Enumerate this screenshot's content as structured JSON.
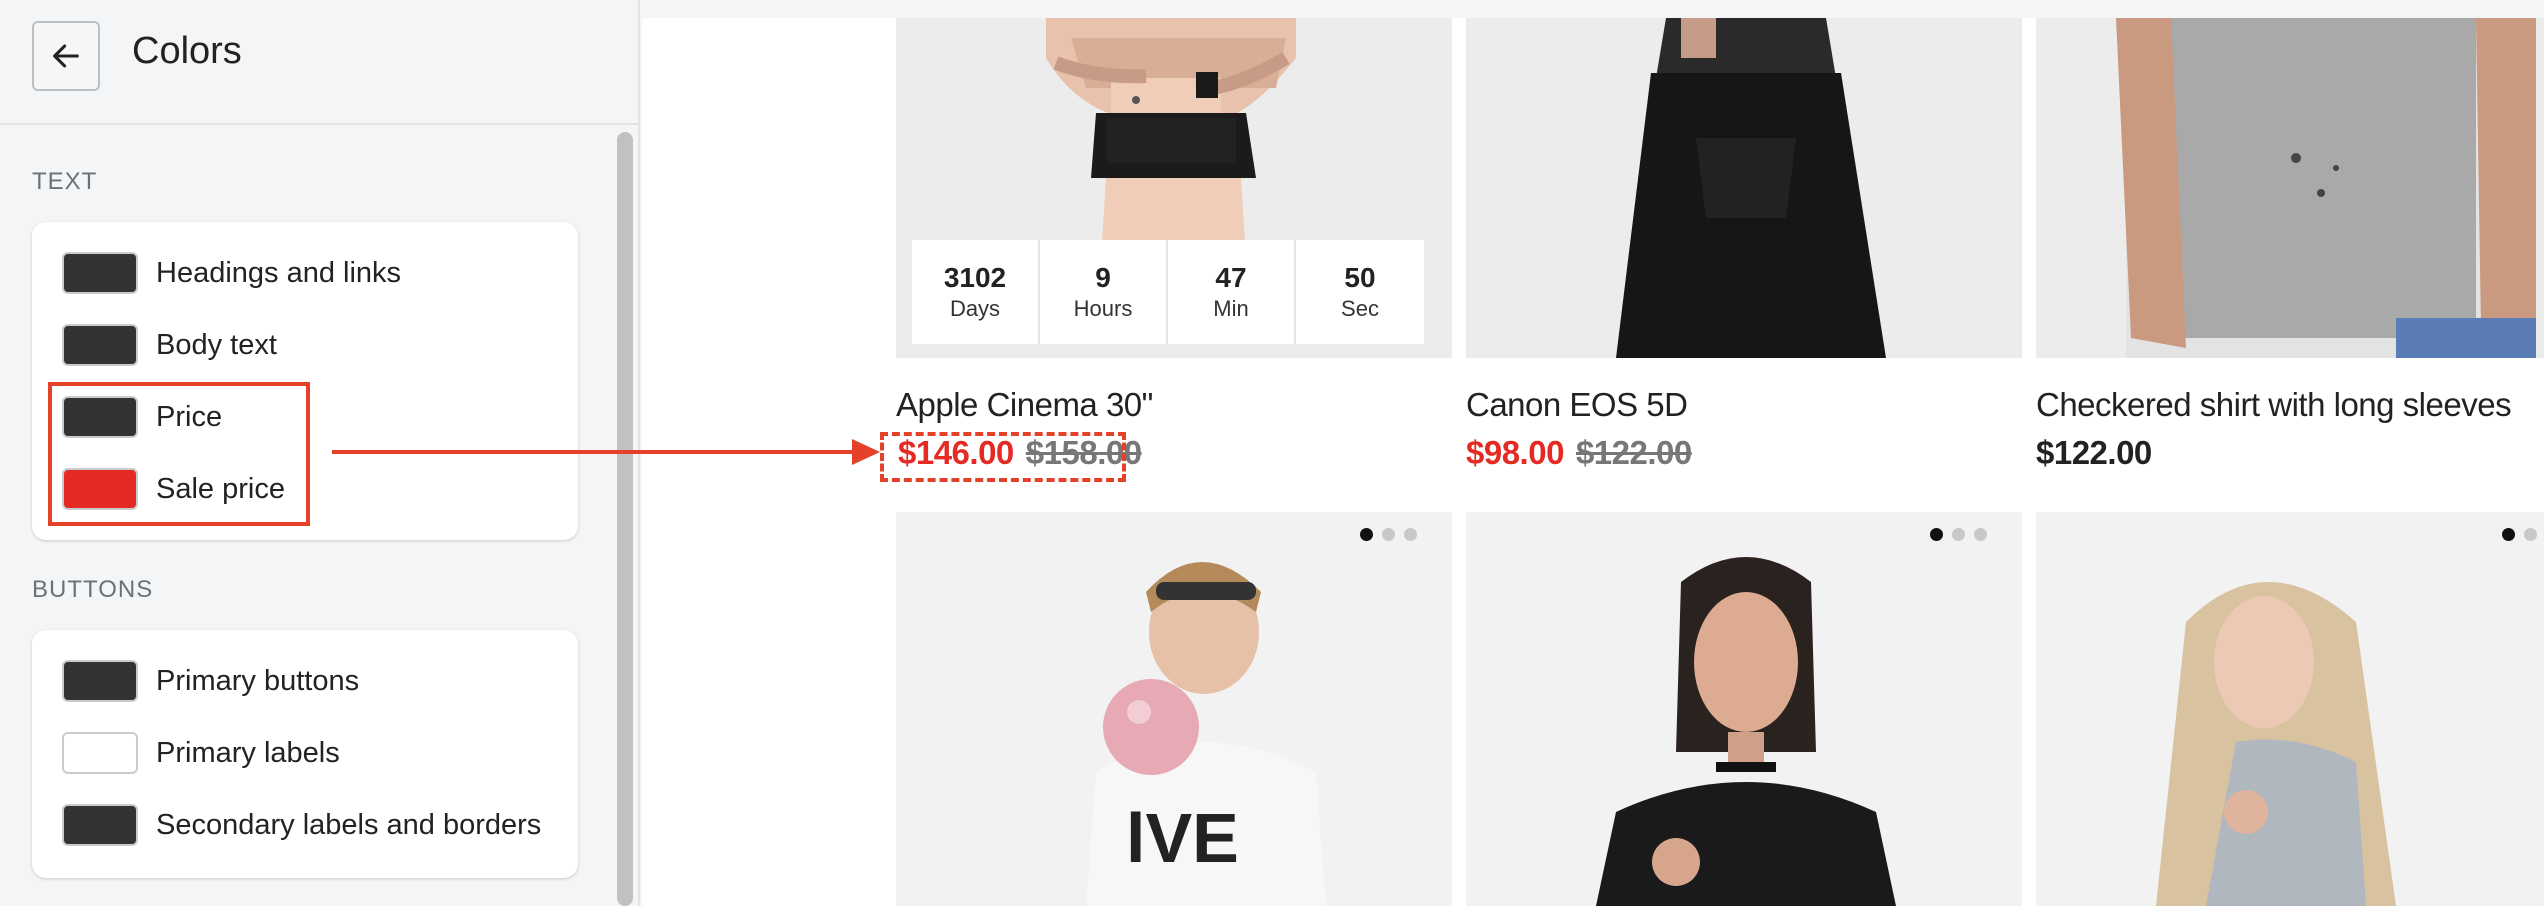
{
  "panel": {
    "title": "Colors",
    "sections": {
      "text": {
        "label": "TEXT",
        "items": [
          {
            "label": "Headings and links",
            "color": "#333333"
          },
          {
            "label": "Body text",
            "color": "#333333"
          },
          {
            "label": "Price",
            "color": "#333333"
          },
          {
            "label": "Sale price",
            "color": "#e32b23"
          }
        ]
      },
      "buttons": {
        "label": "BUTTONS",
        "items": [
          {
            "label": "Primary buttons",
            "color": "#333333"
          },
          {
            "label": "Primary labels",
            "color": "#ffffff"
          },
          {
            "label": "Secondary labels and borders",
            "color": "#333333"
          }
        ]
      }
    }
  },
  "products": [
    {
      "name": "Apple Cinema 30\"",
      "price": "$146.00",
      "old_price": "$158.00"
    },
    {
      "name": "Canon EOS 5D",
      "price": "$98.00",
      "old_price": "$122.00"
    },
    {
      "name": "Checkered shirt with long sleeves",
      "price": "$122.00"
    }
  ],
  "countdown": [
    {
      "value": "3102",
      "unit": "Days"
    },
    {
      "value": "9",
      "unit": "Hours"
    },
    {
      "value": "47",
      "unit": "Min"
    },
    {
      "value": "50",
      "unit": "Sec"
    }
  ],
  "annotation_color": "#e54028"
}
